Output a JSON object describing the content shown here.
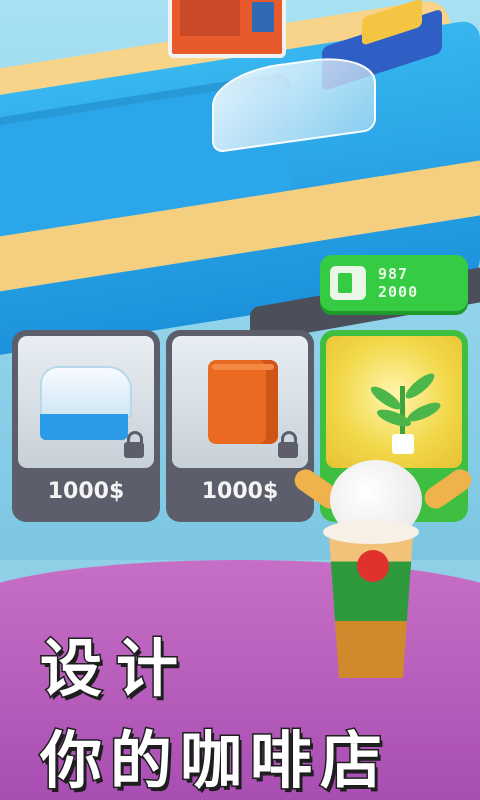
{
  "hud": {
    "badge_line1": "987",
    "badge_line2": "2000"
  },
  "shop": {
    "items": [
      {
        "price": "1000$",
        "locked": true,
        "icon": "display-case-icon"
      },
      {
        "price": "1000$",
        "locked": true,
        "icon": "fridge-icon"
      },
      {
        "price": "",
        "locked": false,
        "icon": "plant-icon"
      }
    ]
  },
  "title": {
    "line1": "设计",
    "line2": "你的咖啡店"
  },
  "colors": {
    "counter_blue": "#1c92dc",
    "counter_wood": "#f7d489",
    "badge_green": "#35cc43",
    "card_gray": "#5c5f6b",
    "floor_purple": "#b05abb"
  }
}
